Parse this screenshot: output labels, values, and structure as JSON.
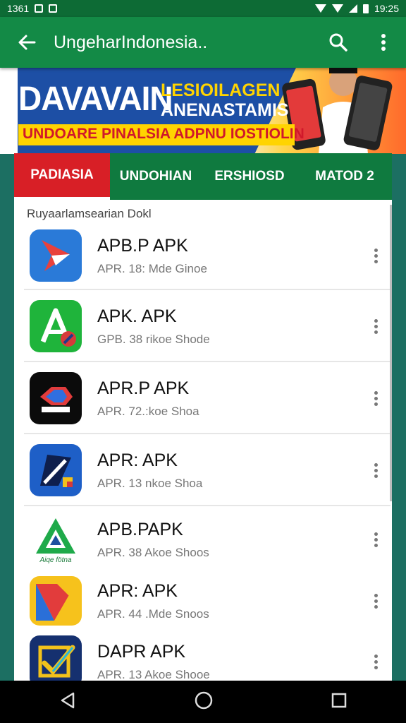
{
  "status_bar": {
    "left_text": "1361",
    "time": "19:25"
  },
  "app_bar": {
    "title": "UngeharIndonesia..",
    "back_icon": "arrow-left-icon",
    "search_icon": "search-icon",
    "menu_icon": "more-vert-icon"
  },
  "banner": {
    "headline": "DAVAVAIN",
    "subline_1": "LESIOILAGEN",
    "subline_2": "ANENASTAMIS",
    "tagline": "UNDOARE PINALSIA ADPNU IOSTIOLIN",
    "colors": {
      "blue": "#1d4fa5",
      "yellow": "#ffd400",
      "red": "#d0182b"
    }
  },
  "tabs": [
    {
      "label": "PADIASIA",
      "active": true
    },
    {
      "label": "UNDOHIAN",
      "active": false
    },
    {
      "label": "ERSHIOSD",
      "active": false
    },
    {
      "label": "MATOD 2",
      "active": false
    }
  ],
  "list": {
    "heading": "Ruyaarlamsearian Dokl",
    "apps": [
      {
        "name": "APB.P APK",
        "meta": "APR. 18: Mde Ginoe",
        "icon": "red-plane-icon"
      },
      {
        "name": "APK. APK",
        "meta": "GPB. 38 rikoe Shode",
        "icon": "green-a-icon"
      },
      {
        "name": "APR.P APK",
        "meta": "APR. 72.:koe Shoa",
        "icon": "dark-logo-icon"
      },
      {
        "name": "APR: APK",
        "meta": "APR. 13 nkoe Shoa",
        "icon": "blue-flag-icon"
      },
      {
        "name": "APB.PAPK",
        "meta": "APR. 38 Akoe Shoos",
        "icon": "green-triangle-icon",
        "icon_caption": "Aiqe fötna"
      },
      {
        "name": "APR: APK",
        "meta": "APR. 44 .Mde Snoos",
        "icon": "colorful-arrow-icon"
      },
      {
        "name": "DAPR APK",
        "meta": "APR. 13 Akoe Shooe",
        "icon": "yellow-check-icon"
      }
    ]
  },
  "nav": {
    "back": "back-triangle-icon",
    "home": "home-circle-icon",
    "recents": "recents-square-icon"
  }
}
